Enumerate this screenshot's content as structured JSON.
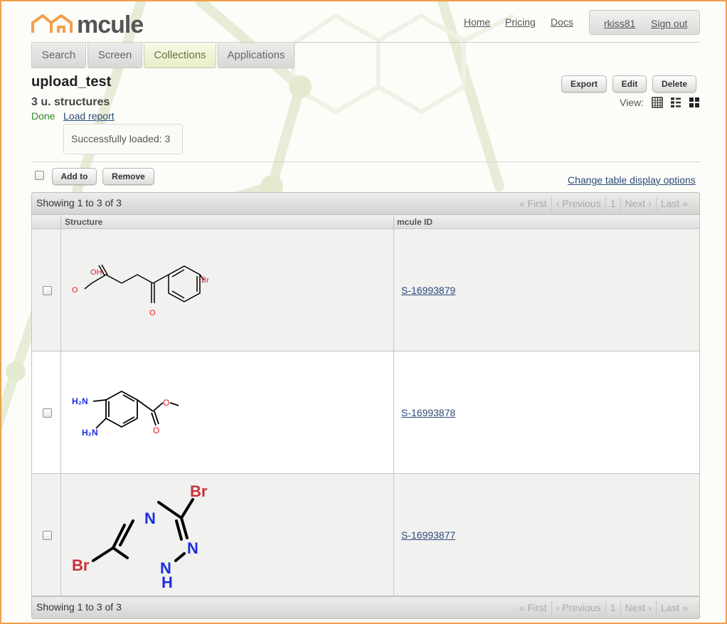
{
  "header": {
    "logo_text": "mcule",
    "nav": {
      "home": "Home",
      "pricing": "Pricing",
      "docs": "Docs"
    },
    "user": {
      "username": "rkiss81",
      "sign_out": "Sign out"
    }
  },
  "tabs": [
    {
      "label": "Search",
      "active": false
    },
    {
      "label": "Screen",
      "active": false
    },
    {
      "label": "Collections",
      "active": true
    },
    {
      "label": "Applications",
      "active": false
    }
  ],
  "collection": {
    "title": "upload_test",
    "count": "3 u. structures",
    "status": "Done",
    "load_report": "Load report",
    "load_message": "Successfully loaded: 3"
  },
  "actions": {
    "export": "Export",
    "edit": "Edit",
    "delete": "Delete",
    "view_label": "View:"
  },
  "view_icons": [
    "table-view-icon",
    "list-view-icon",
    "grid-view-icon"
  ],
  "toolbar": {
    "add_to": "Add to",
    "remove": "Remove",
    "display_options": "Change table display options"
  },
  "pager": {
    "showing": "Showing 1 to 3 of 3",
    "first": "« First",
    "previous": "‹ Previous",
    "page": "1",
    "next": "Next ›",
    "last": "Last »"
  },
  "table": {
    "columns": {
      "structure": "Structure",
      "mcule_id": "mcule ID"
    },
    "rows": [
      {
        "id": "S-16993879",
        "structure": "4-(4-bromophenyl)-4-oxobutanoic acid",
        "atom_labels": [
          "OH",
          "O",
          "O",
          "Br"
        ]
      },
      {
        "id": "S-16993878",
        "structure": "methyl 3,4-diaminobenzoate",
        "atom_labels": [
          "H₂N",
          "H₂N",
          "O",
          "O"
        ]
      },
      {
        "id": "S-16993877",
        "structure": "3,5-dibromo-1H-1,2,4-triazole",
        "atom_labels": [
          "Br",
          "N",
          "N",
          "N",
          "H",
          "Br"
        ]
      }
    ]
  },
  "colors": {
    "accent_orange": "#f0a04a",
    "link": "#2d4a78",
    "done_green": "#2c8a2c",
    "oxygen_red": "#e8181c",
    "nitrogen_blue": "#1a2ee0",
    "bromine_red": "#c8323a"
  }
}
